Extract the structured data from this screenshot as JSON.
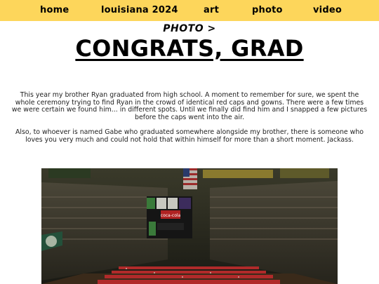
{
  "nav": {
    "items": [
      {
        "label": "home"
      },
      {
        "label": "louisiana 2024"
      },
      {
        "label": "art"
      },
      {
        "label": "photo"
      },
      {
        "label": "video"
      }
    ],
    "accent": "#fdd65b"
  },
  "breadcrumb": "PHOTO >",
  "page_title": "CONGRATS, GRAD",
  "body": {
    "paragraph1": "This year my brother Ryan graduated from high school. A moment to remember for sure, we spent the whole ceremony trying to find Ryan in the crowd of identical red caps and gowns. There were a few times we were certain we found him... in different spots. Until we finally did find him and I snapped a few pictures before the caps went into the air.",
    "paragraph2": "Also, to whoever is named Gabe who graduated somewhere alongside my brother, there is someone who loves you very much and could not hold that within himself for more than a short moment. Jackass."
  },
  "photo": {
    "description_icon": "arena-graduation-photo",
    "scoreboard_text": "coca-cola"
  }
}
